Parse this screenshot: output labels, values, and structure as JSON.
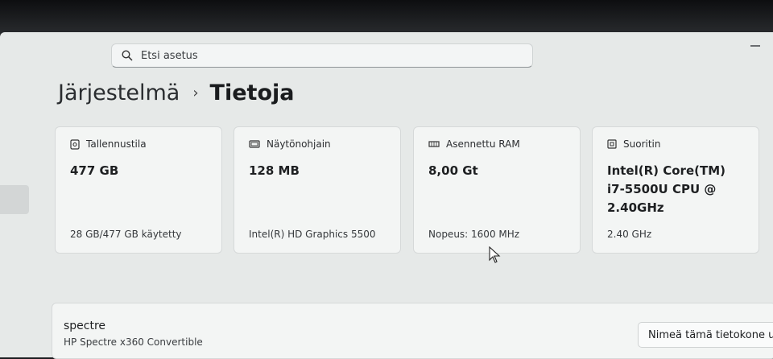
{
  "search": {
    "placeholder": "Etsi asetus"
  },
  "breadcrumb": {
    "parent": "Järjestelmä",
    "current": "Tietoja"
  },
  "cards": [
    {
      "title": "Tallennustila",
      "value": "477 GB",
      "sub": "28 GB/477 GB käytetty",
      "icon": "storage-icon"
    },
    {
      "title": "Näytönohjain",
      "value": "128 MB",
      "sub": "Intel(R) HD Graphics 5500",
      "icon": "display-adapter-icon"
    },
    {
      "title": "Asennettu RAM",
      "value": "8,00 Gt",
      "sub": "Nopeus: 1600 MHz",
      "icon": "memory-icon"
    },
    {
      "title": "Suoritin",
      "value_lines": [
        "Intel(R) Core(TM)",
        "i7-5500U CPU @",
        "2.40GHz"
      ],
      "sub": "2.40 GHz",
      "icon": "processor-icon"
    }
  ],
  "device": {
    "name": "spectre",
    "model": "HP Spectre x360 Convertible",
    "rename_label": "Nimeä tämä tietokone u"
  }
}
